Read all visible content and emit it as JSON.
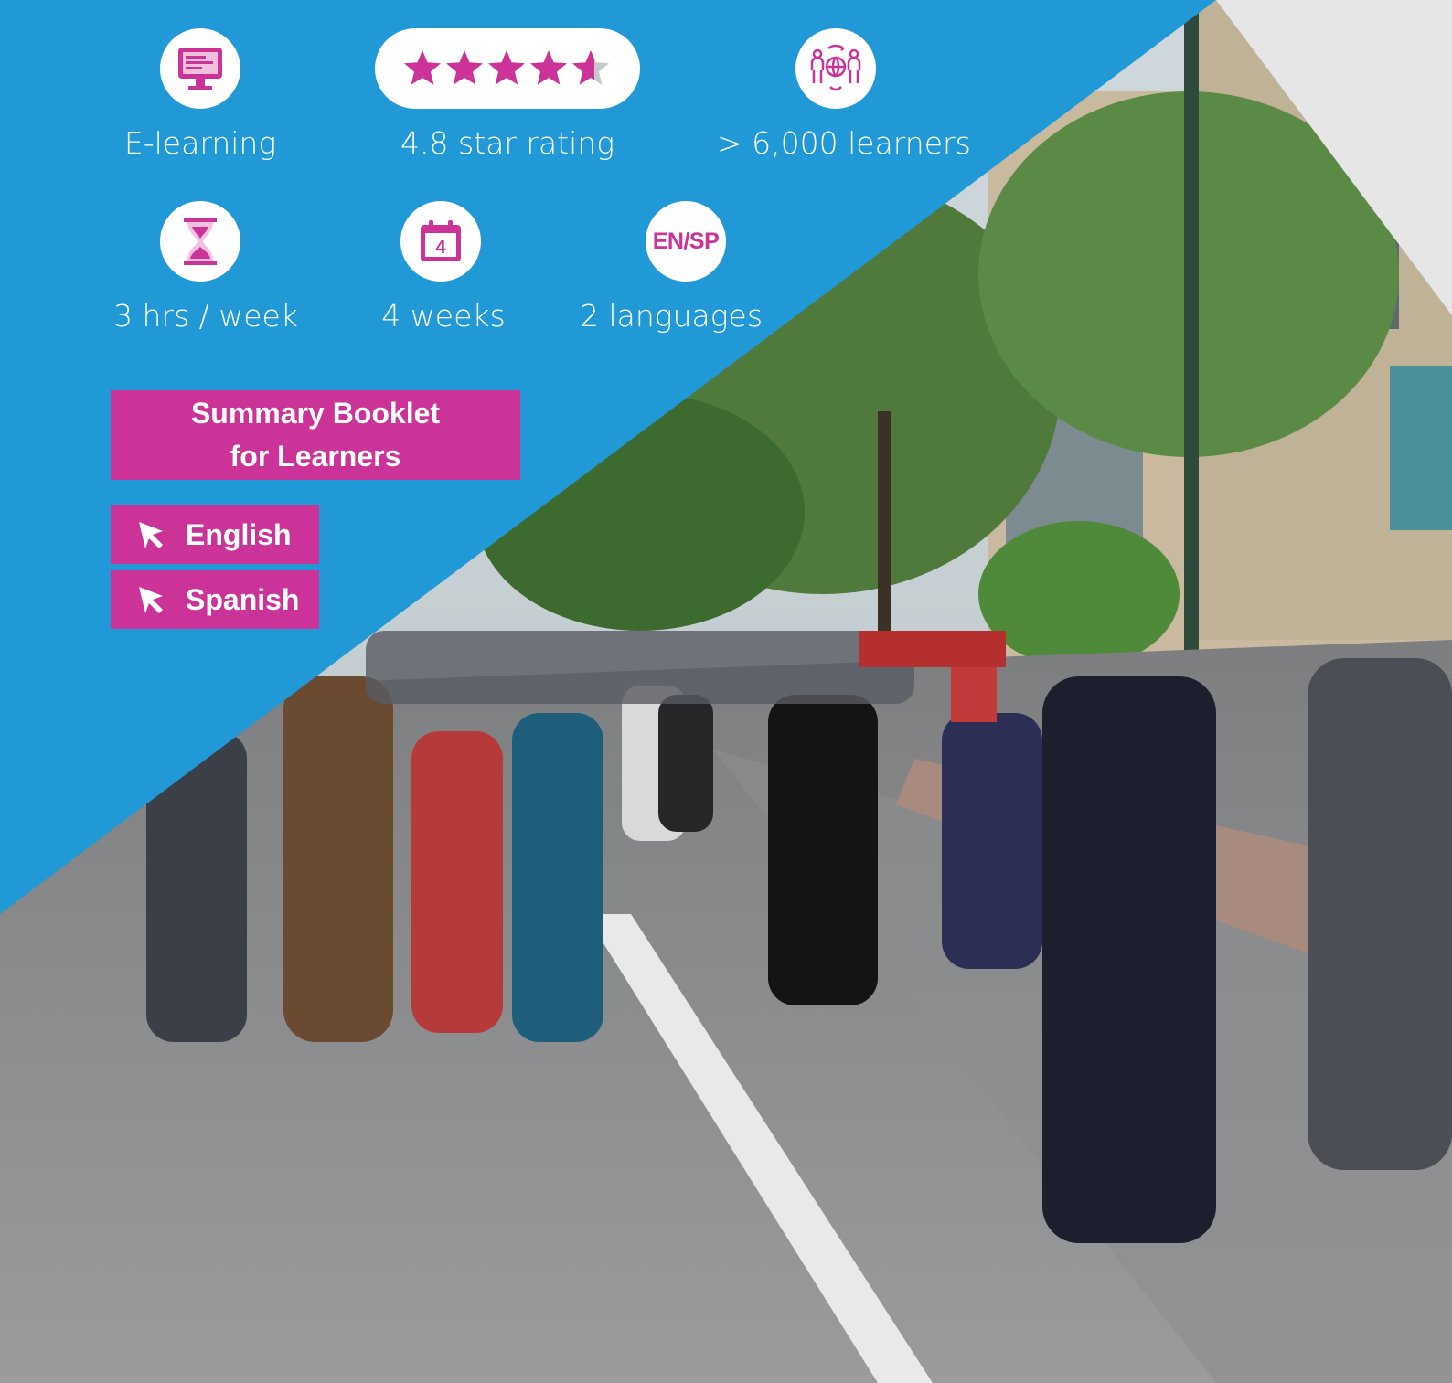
{
  "stats": [
    {
      "icon": "computer-monitor-icon",
      "label": "E-learning"
    },
    {
      "icon": "star-rating-icon",
      "label": "4.8 star rating",
      "rating": 4.8,
      "rating_max": 5
    },
    {
      "icon": "global-learners-icon",
      "label": "> 6,000 learners"
    },
    {
      "icon": "hourglass-icon",
      "label": "3 hrs / week"
    },
    {
      "icon": "calendar-icon",
      "label": "4 weeks",
      "calendar_number": "4"
    },
    {
      "icon": "languages-icon",
      "label": "2 languages",
      "badge": "EN/SP"
    }
  ],
  "booklet": {
    "line1": "Summary Booklet",
    "line2": "for Learners",
    "links": [
      {
        "label": "English",
        "icon": "cursor-arrow-icon"
      },
      {
        "label": "Spanish",
        "icon": "cursor-arrow-icon"
      }
    ]
  },
  "colors": {
    "blue": "#2199d6",
    "magenta": "#cc3399",
    "grey": "#e6e6e6",
    "white": "#ffffff"
  }
}
